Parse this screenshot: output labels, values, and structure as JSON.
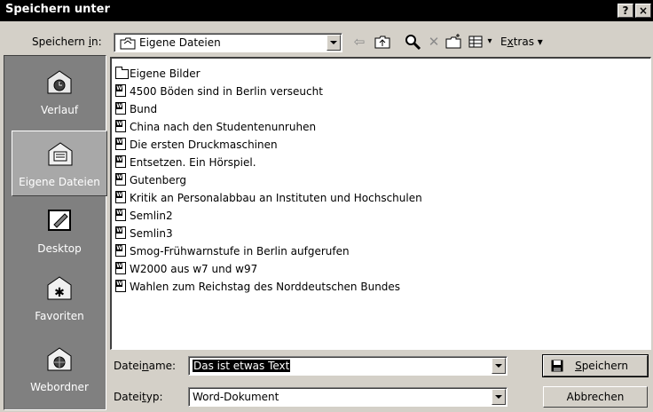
{
  "window": {
    "title": "Speichern unter",
    "help_label": "?",
    "close_label": "×"
  },
  "toolbar": {
    "lookin_label_pre": "Speichern ",
    "lookin_label_u": "i",
    "lookin_label_post": "n:",
    "lookin_value": "Eigene Dateien",
    "extras_pre": "E",
    "extras_u": "x",
    "extras_post": "tras ▾"
  },
  "places": [
    {
      "label": "Verlauf"
    },
    {
      "label": "Eigene Dateien"
    },
    {
      "label": "Desktop"
    },
    {
      "label": "Favoriten"
    },
    {
      "label": "Webordner"
    }
  ],
  "files": [
    {
      "name": "Eigene Bilder",
      "type": "folder"
    },
    {
      "name": "4500 Böden sind in Berlin verseucht",
      "type": "doc"
    },
    {
      "name": "Bund",
      "type": "doc"
    },
    {
      "name": "China nach den Studentenunruhen",
      "type": "doc"
    },
    {
      "name": "Die ersten Druckmaschinen",
      "type": "doc"
    },
    {
      "name": "Entsetzen. Ein Hörspiel.",
      "type": "doc"
    },
    {
      "name": "Gutenberg",
      "type": "doc"
    },
    {
      "name": "Kritik an Personalabbau an Instituten und Hochschulen",
      "type": "doc"
    },
    {
      "name": "Semlin2",
      "type": "doc"
    },
    {
      "name": "Semlin3",
      "type": "doc"
    },
    {
      "name": "Smog-Frühwarnstufe in Berlin aufgerufen",
      "type": "doc"
    },
    {
      "name": "W2000 aus w7 und w97",
      "type": "doc"
    },
    {
      "name": "Wahlen zum Reichstag des Norddeutschen Bundes",
      "type": "doc"
    }
  ],
  "filename": {
    "label_pre": "Datei",
    "label_u": "n",
    "label_post": "ame:",
    "value": "Das ist etwas Text"
  },
  "filetype": {
    "label_pre": "Datei",
    "label_u": "t",
    "label_post": "yp:",
    "value": "Word-Dokument"
  },
  "buttons": {
    "save_u": "S",
    "save_rest": "peichern",
    "cancel": "Abbrechen"
  }
}
